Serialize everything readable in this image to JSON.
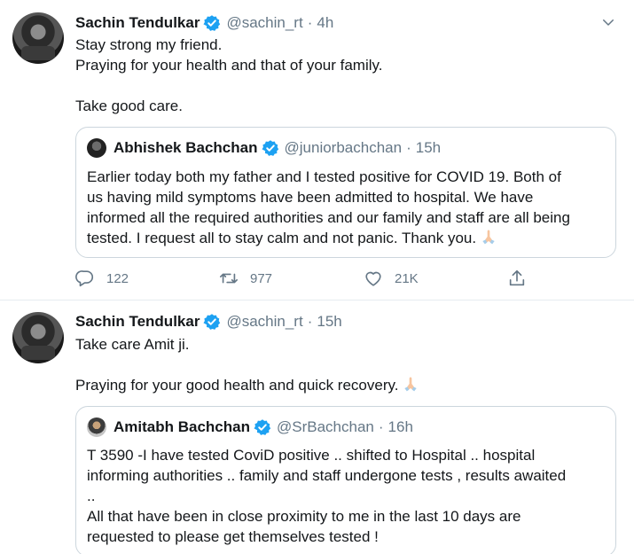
{
  "colors": {
    "verified": "#1da1f2",
    "secondary_text": "#657786",
    "border": "#ccd6dd"
  },
  "tweets": [
    {
      "author": {
        "name": "Sachin Tendulkar",
        "handle": "@sachin_rt",
        "time": "4h",
        "separator": "·"
      },
      "lines": [
        "Stay strong my friend.",
        "Praying for your health and that of your family.",
        "",
        "Take good care."
      ],
      "quote": {
        "author": {
          "name": "Abhishek Bachchan",
          "handle": "@juniorbachchan",
          "time": "15h",
          "separator": "·"
        },
        "lines": [
          "Earlier today both my father and I tested positive for COVID 19. Both of",
          "us having mild symptoms have been admitted to hospital. We have",
          "informed all the required authorities and our family and staff are all being",
          "tested. I request all to stay calm and not panic. Thank you."
        ],
        "emoji": "folded-hands-emoji"
      },
      "actions": {
        "replies": "122",
        "retweets": "977",
        "likes": "21K"
      }
    },
    {
      "author": {
        "name": "Sachin Tendulkar",
        "handle": "@sachin_rt",
        "time": "15h",
        "separator": "·"
      },
      "lines": [
        "Take care Amit ji.",
        "",
        "Praying for your good health and quick recovery."
      ],
      "emoji": "folded-hands-emoji",
      "quote": {
        "author": {
          "name": "Amitabh Bachchan",
          "handle": "@SrBachchan",
          "time": "16h",
          "separator": "·"
        },
        "lines": [
          "T 3590 -I have tested CoviD positive ..  shifted to Hospital  .. hospital",
          "informing  authorities .. family and staff undergone tests , results awaited",
          "..",
          "All that have been in close proximity to me in the last 10 days are",
          "requested to please get themselves tested !"
        ]
      }
    }
  ]
}
